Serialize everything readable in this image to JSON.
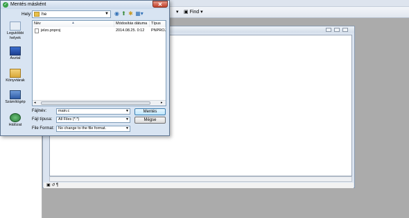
{
  "dialog": {
    "title": "Mentés másként",
    "location_label": "Hely:",
    "location_value": "he",
    "places": [
      {
        "label": "Legutóbbi helyek",
        "icon": "recent-places-icon"
      },
      {
        "label": "Asztal",
        "icon": "desktop-icon"
      },
      {
        "label": "Könyvtárak",
        "icon": "libraries-icon"
      },
      {
        "label": "Számítógép",
        "icon": "computer-icon"
      },
      {
        "label": "Hálózat",
        "icon": "network-icon"
      }
    ],
    "columns": {
      "name": "Név",
      "date": "Módosítás dátuma",
      "type": "Típus"
    },
    "files": [
      {
        "name": "jelzo.pnproj",
        "date": "2014.08.25. 0:12",
        "type": "PNPROJ f."
      }
    ],
    "filename_label": "Fájlnév:",
    "filename_value": "main.c",
    "filetype_label": "Fájl típusa:",
    "filetype_value": "All Files (*.*)",
    "fileformat_label": "File Format:",
    "fileformat_value": "No change to the file format.",
    "save_button": "Mentés",
    "cancel_button": "Mégse"
  },
  "app": {
    "find_label": "Find"
  },
  "colors": {
    "dialog_bg": "#d8e4f2",
    "accent": "#3c7fb1"
  }
}
